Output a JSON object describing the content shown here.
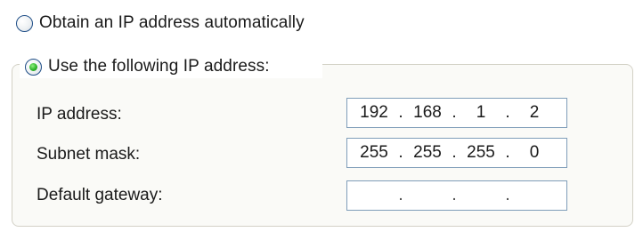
{
  "options": {
    "auto": {
      "label": "Obtain an IP address automatically",
      "selected": false
    },
    "manual": {
      "label": "Use the following IP address:",
      "selected": true
    }
  },
  "fields": [
    {
      "label": "IP address:",
      "octets": [
        "192",
        "168",
        "1",
        "2"
      ]
    },
    {
      "label": "Subnet mask:",
      "octets": [
        "255",
        "255",
        "255",
        "0"
      ]
    },
    {
      "label": "Default gateway:",
      "octets": [
        "",
        "",
        "",
        ""
      ]
    }
  ],
  "separator": "."
}
